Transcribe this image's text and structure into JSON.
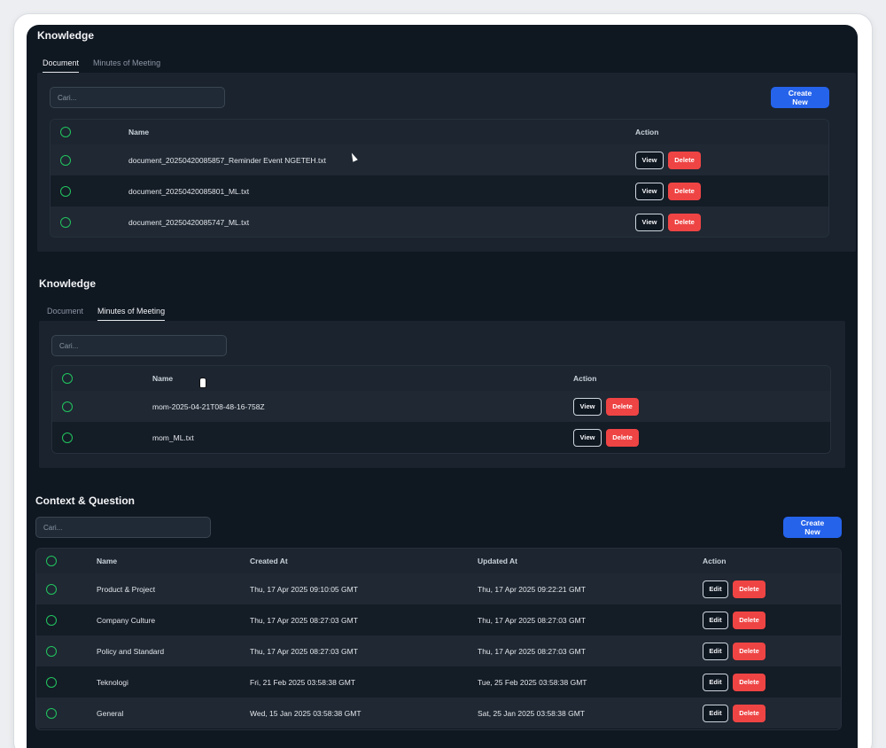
{
  "knowledge_doc": {
    "title": "Knowledge",
    "tabs": [
      {
        "label": "Document"
      },
      {
        "label": "Minutes of Meeting"
      }
    ],
    "search_placeholder": "Cari...",
    "create_label": "Create New",
    "columns": {
      "name": "Name",
      "action": "Action"
    },
    "rows": [
      {
        "name": "document_20250420085857_Reminder Event NGETEH.txt"
      },
      {
        "name": "document_20250420085801_ML.txt"
      },
      {
        "name": "document_20250420085747_ML.txt"
      }
    ],
    "view_label": "View",
    "delete_label": "Delete"
  },
  "knowledge_mom": {
    "title": "Knowledge",
    "tabs": [
      {
        "label": "Document"
      },
      {
        "label": "Minutes of Meeting"
      }
    ],
    "search_placeholder": "Cari...",
    "columns": {
      "name": "Name",
      "action": "Action"
    },
    "rows": [
      {
        "name": "mom-2025-04-21T08-48-16-758Z"
      },
      {
        "name": "mom_ML.txt"
      }
    ],
    "view_label": "View",
    "delete_label": "Delete"
  },
  "context": {
    "title": "Context & Question",
    "search_placeholder": "Cari...",
    "create_label": "Create New",
    "columns": {
      "name": "Name",
      "created": "Created At",
      "updated": "Updated At",
      "action": "Action"
    },
    "rows": [
      {
        "name": "Product & Project",
        "created": "Thu, 17 Apr 2025 09:10:05 GMT",
        "updated": "Thu, 17 Apr 2025 09:22:21 GMT"
      },
      {
        "name": "Company Culture",
        "created": "Thu, 17 Apr 2025 08:27:03 GMT",
        "updated": "Thu, 17 Apr 2025 08:27:03 GMT"
      },
      {
        "name": "Policy and Standard",
        "created": "Thu, 17 Apr 2025 08:27:03 GMT",
        "updated": "Thu, 17 Apr 2025 08:27:03 GMT"
      },
      {
        "name": "Teknologi",
        "created": "Fri, 21 Feb 2025 03:58:38 GMT",
        "updated": "Tue, 25 Feb 2025 03:58:38 GMT"
      },
      {
        "name": "General",
        "created": "Wed, 15 Jan 2025 03:58:38 GMT",
        "updated": "Sat, 25 Jan 2025 03:58:38 GMT"
      }
    ],
    "edit_label": "Edit",
    "delete_label": "Delete"
  },
  "colors": {
    "background": "#0f1721",
    "panel": "#1a232e",
    "accent_blue": "#2563eb",
    "danger_red": "#ef4444",
    "radio_green": "#22c55e"
  }
}
